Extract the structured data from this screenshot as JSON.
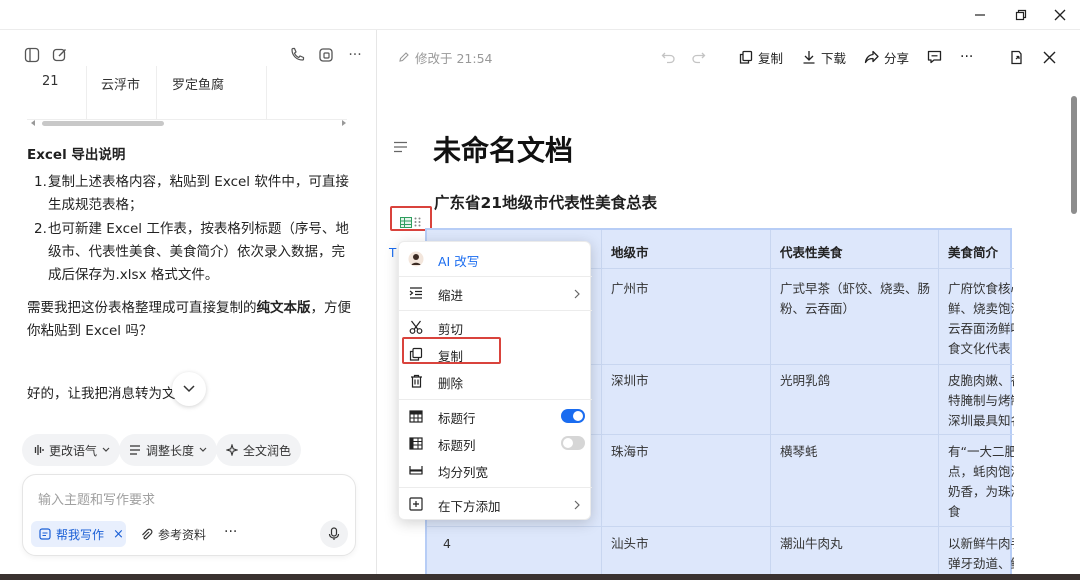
{
  "left_panel": {
    "table_row": {
      "no": "21",
      "city": "云浮市",
      "food": "罗定鱼腐"
    },
    "section_title": "Excel 导出说明",
    "list": [
      {
        "num": "1.",
        "lines": [
          "复制上述表格内容，粘贴到 Excel 软件中，可直接",
          "生成规范表格；"
        ]
      },
      {
        "num": "2.",
        "lines": [
          "也可新建 Excel 工作表，按表格列标题（序号、地",
          "级市、代表性美食、美食简介）依次录入数据，完",
          "成后保存为.xlsx 格式文件。"
        ]
      }
    ],
    "question": {
      "line1_a": "需要我把这份表格整理成可直接复制的",
      "line1_bold": "纯文本版",
      "line1_b": "，方便",
      "line2": "你粘贴到 Excel 吗？"
    },
    "reply": "好的，让我把消息转为文",
    "chips": [
      "更改语气",
      "调整长度",
      "全文润色"
    ],
    "input_placeholder": "输入主题和写作要求",
    "write_tag": "帮我写作",
    "reference": "参考资料",
    "more": "···"
  },
  "doc_toolbar": {
    "modified": "修改于 21:54",
    "copy": "复制",
    "download": "下载",
    "share": "分享",
    "more": "···"
  },
  "document": {
    "title": "未命名文档",
    "subtitle": "广东省21地级市代表性美食总表",
    "headers": [
      "地级市",
      "代表性美食",
      "美食简介"
    ],
    "rows": [
      {
        "city": "广州市",
        "food": [
          "广式早茶（虾饺、烧卖、肠",
          "粉、云吞面）"
        ],
        "intro": [
          "广府饮食核心",
          "鲜、烧卖饱满",
          "云吞面汤鲜味",
          "食文化代表"
        ]
      },
      {
        "city": "深圳市",
        "food": [
          "光明乳鸽"
        ],
        "intro": [
          "皮脆肉嫩、香",
          "特腌制与烤制",
          "深圳最具知名"
        ]
      },
      {
        "city": "珠海市",
        "food": [
          "横琴蚝"
        ],
        "intro": [
          "有“一大二肥",
          "点，蚝肉饱满",
          "奶香，为珠海",
          "食"
        ]
      },
      {
        "no": "4",
        "city": "汕头市",
        "food": [
          "潮汕牛肉丸"
        ],
        "intro": [
          "以新鲜牛肉手",
          "弹牙劲道、鲜"
        ]
      }
    ]
  },
  "context_menu": {
    "items": {
      "ai_rewrite": "AI 改写",
      "indent": "缩进",
      "cut": "剪切",
      "copy": "复制",
      "delete": "删除",
      "header_row": "标题行",
      "header_col": "标题列",
      "equal_width": "均分列宽",
      "add_below": "在下方添加"
    },
    "header_row_on": true,
    "header_col_on": false
  },
  "colors": {
    "accent": "#1a6cf0",
    "highlight": "#d9433c",
    "table_bg": "#dde7fb"
  }
}
